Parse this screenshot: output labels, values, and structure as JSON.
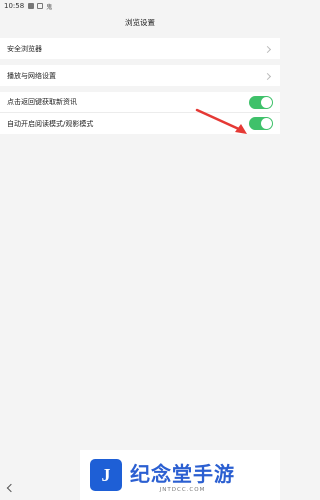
{
  "status_bar": {
    "time": "10:58",
    "icons": [
      "app-icon",
      "square-icon"
    ],
    "char": "鬼"
  },
  "header": {
    "title": "浏览设置"
  },
  "groups": [
    {
      "items": [
        {
          "label": "安全浏览器",
          "control": "chevron"
        }
      ]
    },
    {
      "items": [
        {
          "label": "播放与网络设置",
          "control": "chevron"
        }
      ]
    },
    {
      "items": [
        {
          "label": "点击返回键获取新资讯",
          "control": "toggle",
          "on": true
        },
        {
          "label": "自动开启阅读模式/观影模式",
          "control": "toggle",
          "on": true
        }
      ]
    }
  ],
  "annotation": {
    "arrow_color": "#e53935"
  },
  "watermark": {
    "title": "纪念堂手游",
    "subtitle": "JNTDCC.COM",
    "logo_letter": "J"
  },
  "colors": {
    "toggle_on": "#3fc16a",
    "background": "#f4f4f4",
    "brand": "#2b5fd1"
  }
}
